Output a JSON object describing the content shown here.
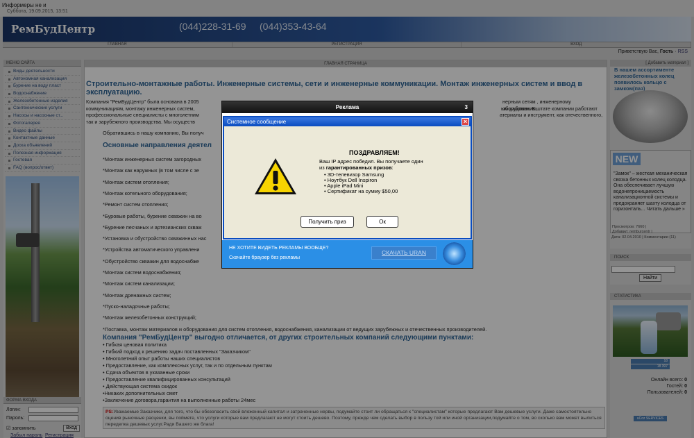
{
  "top": {
    "informers": "Информеры не и",
    "date": "Суббота, 19.09.2015, 13:51"
  },
  "header": {
    "brand": "РемБудЦентр",
    "phone1": "(044)228-31-69",
    "phone2": "(044)353-43-64"
  },
  "nav": {
    "items": [
      "ГЛАВНАЯ",
      "РЕГИСТРАЦИЯ",
      "ВХОД"
    ]
  },
  "greeting": {
    "prefix": "Приветствую Вас,",
    "user": "Гость",
    "sep": "·",
    "rss": "RSS"
  },
  "left_menu": {
    "title": "МЕНЮ САЙТА",
    "items": [
      "Виды деятельности",
      "Автономная канализация",
      "Бурение на воду пласт",
      "Водоснабжение",
      "Железобетонные изделия",
      "Сантехнические услуги",
      "Насосы и насосные ст...",
      "Фотогалерея",
      "Видео файлы",
      "Контактные данные",
      "Доска объявлений",
      "Полезная информация",
      "Гостевая",
      "FAQ (вопрос/ответ)"
    ]
  },
  "login": {
    "title": "ФОРМА ВХОДА",
    "login_label": "Логин:",
    "password_label": "Пароль:",
    "remember": "запомнить",
    "submit": "Вход",
    "forgot": "Забыл пароль",
    "register": "Регистрация"
  },
  "main": {
    "header": "ГЛАВНАЯ СТРАНИЦА",
    "title": "Строительно-монтажные работы. Инженерные системы, сети и инженерные коммуникации. Монтаж инженерных систем и ввод в эксплуатацию.",
    "intro_1": "Компания \"РемБудЦентр\" была основана в 2005",
    "intro_1b": "нерным сетям , инженерному оборудованию,",
    "intro_2": "коммуникациям, монтажу инженерных систем,",
    "intro_2b": "ым работам. В штате компании работают",
    "intro_3": "профессиональные специалисты с многолетним",
    "intro_3b": "атериалы и инструмент, как отечественного,",
    "intro_4": "так и зарубежного производства. Мы осуществ",
    "contact_line": "Обратившись в нашу компанию, Вы получ",
    "directions_title": "Основные направления деятел",
    "services": [
      "*Монтаж инженерных систем загородных",
      "*Монтаж как наружных (в том числе с зе",
      "*Монтаж систем отопления;",
      "*Монтаж котельного оборудования;",
      "*Ремонт систем отопления;",
      "*Буровые работы, бурение скважин на во",
      "*Бурение песчаных и артезианских скваж",
      "*Установка и обустройство скважинных нас",
      "*Устройства автоматического управлени",
      "*Обустройство скважин для водоснабже",
      "*Монтаж систем водоснабжения;",
      "*Монтаж систем канализации;",
      "*Монтаж дренажных систем;",
      "*Пуско-наладочные работы;",
      "*Монтаж железобетонных конструкций;",
      "*Поставка, монтаж материалов и оборудования для систем отопления, водоснабжения, канализации от ведущих зарубежных и отечественных производителей."
    ],
    "advantages_title": "Компания \"РемБудЦентр\" выгодно отличается, от других строительных компаний следующими пунктами:",
    "advantages": [
      "• Гибкая ценовая политика",
      "• Гибкий подход к решению задач поставленных \"Заказчиком\"",
      "• Многолетний опыт работы наших специалистов",
      "• Предоставление, как комплексных услуг, так и по отдельным пунктам",
      "• Сдача объектов в указанные сроки",
      "• Предоставление квалифицированных консультаций",
      "• Действующая система скидок",
      "•Никаких дополнительных смет",
      "•Заключение договора,гарантия на выполненные работы 24мес"
    ],
    "ps_label": "PS:",
    "ps_text": "Уважаемые Заказчики, для того, что бы обезопасить свой вложенный капитал и затраченные нервы, подумайте стоит ли обращаться к \"специалистам\" которые предлагают Вам дешевые услуги. Даже самостоятельно оценив рыночные расценки, вы поймете, что услуги которые вам предлагают не могут стоить дешево. Поэтому, прежде чем сделать выбор в пользу той или иной организации,подумайте о том, во сколько вам может вылиться переделка дешевых услуг.Ради Вашего же блага!"
  },
  "right": {
    "ad_header": "[ Добавить материал ]",
    "ad_title": "В нашем ассортименте железобетонных колец появилось кольцо с замком(паз)",
    "new_tag": "NEW",
    "new_text": "\"Замок\" – жесткая механическая связка бетонных колец колодца. Она обеспечивает лучшую водонепроницаемость канализационной системы и предохраняет шахту колодца от горизонталь... Читать дальше »",
    "views": "Просмотров: 7660 |",
    "added": "Добавил: remburcentr |",
    "date": "Дата: 02.04.2010 | Комментарии (11)",
    "search_title": "ПОИСК",
    "search_btn": "Найти",
    "stat_title": "СТАТИСТИКА",
    "counter1": "18",
    "counter2": "18 397",
    "online_label": "Онлайн всего:",
    "online_val": "0",
    "guests_label": "Гостей:",
    "guests_val": "0",
    "users_label": "Пользователей:",
    "users_val": "0",
    "ucoz": "uCoz SERVICES"
  },
  "advert": {
    "header": "Реклама",
    "count": "3",
    "dialog_title": "Системное сообщение",
    "congrats": "ПОЗДРАВЛЯЕМ!",
    "message_1": "Ваш IP адрес победил. Вы получаете один",
    "message_2": "из",
    "message_bold": "гарантированных призов",
    "message_end": ":",
    "prizes": [
      "3D-телевизор Samsung",
      "Ноутбук Dell Inspiron",
      "Apple iPad Mini",
      "Сертификат на сумму $50,00"
    ],
    "get_prize": "Получить приз",
    "ok": "Ок",
    "banner_question": "НЕ ХОТИТЕ ВИДЕТЬ РЕКЛАМЫ ВООБЩЕ?",
    "banner_sub": "Скачайте браузер без рекламы",
    "download": "СКАЧАТЬ URAN"
  },
  "colors": {
    "header_bg": "#1b2e5e",
    "title_blue": "#2e6596",
    "dialog_border": "#0a4cc0",
    "banner_blue": "#2b8fe6"
  }
}
